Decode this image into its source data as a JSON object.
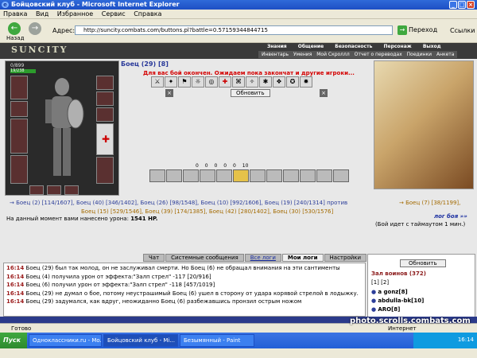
{
  "window": {
    "title": "Бойцовский клуб - Microsoft Internet Explorer"
  },
  "menu": [
    "Правка",
    "Вид",
    "Избранное",
    "Сервис",
    "Справка"
  ],
  "toolbar": {
    "back_label": "Назад",
    "address_label": "Адрес:",
    "address_value": "http://suncity.combats.com/buttons.pl?battle=0.57159344844715",
    "go_label": "Переход",
    "links_label": "Ссылки"
  },
  "site": {
    "logo": "SUNCITY",
    "nav_top": [
      "Знания",
      "Общение",
      "Безопасность",
      "Персонаж",
      "Выход"
    ],
    "nav_bottom": [
      "Инвентарь",
      "Умения",
      "Мой Скроллл",
      "Отчет о переводах",
      "Поединки",
      "Анкета"
    ]
  },
  "character": {
    "hp": "0/899",
    "mana": "19/238",
    "title": "Боец (29) [8]"
  },
  "battle": {
    "message": "Для вас бой окончен. Ожидаем пока закончат и другие игроки...",
    "refresh_label": "Обновить",
    "counters": [
      "0",
      "0",
      "0",
      "0",
      "0",
      "10"
    ],
    "team1": "→ Боец (2) [114/1607], Боец (40) [346/1402], Боец (26) [98/1548], Боец (10) [992/1606], Боец (19) [240/1314] против",
    "team1_cont": "Боец (15) [529/1546], Боец (39) [174/1385], Боец (42) [280/1402], Боец (30) [530/1576]",
    "team2": "→ Боец (7) [38/1199],",
    "damage_text": "На данный момент вами нанесено урона:",
    "damage_value": "1541 HP.",
    "fightlog_link": "лог боя »»",
    "timeout_text": "(Бой идет с таймаутом 1 мин.)"
  },
  "chat": {
    "tabs": [
      "Чат",
      "Системные сообщения",
      "Все логи",
      "Мои логи",
      "Настройки"
    ],
    "lines": [
      {
        "time": "16:14",
        "text": "Боец (29) был так молод, он не заслуживал смерти. Но Боец (6) не обращал внимания на эти сантименты"
      },
      {
        "time": "16:14",
        "text": "Боец (4) получила урон от эффекта:\"Залп стрел\" -117 [20/916]"
      },
      {
        "time": "16:14",
        "text": "Боец (6) получил урон от эффекта:\"Залп стрел\" -118 [457/1019]"
      },
      {
        "time": "16:14",
        "text": "Боец (29) не думал о бое, потому неустрашимый Боец (6) ушел в сторону от удара корявой стрелой в лодыжку."
      },
      {
        "time": "16:14",
        "text": "Боец (29) задумался, как вдруг, неожиданно Боец (6) разбежавшись пронзил острым ножом"
      }
    ]
  },
  "side": {
    "refresh_label": "Обновить",
    "title": "Зал воинов (372)",
    "pages": "[1] [2]",
    "warriors": [
      "a gonz[8]",
      "abdulla-bk[10]",
      "ARO[8]"
    ]
  },
  "status": {
    "left": "Готово",
    "zone": "Интернет"
  },
  "taskbar": {
    "start": "Пуск",
    "tasks": [
      "Одноклассники.ru - Mo...",
      "Бойцовский клуб - Mi...",
      "Безымянный - Paint"
    ],
    "clock": "16:14"
  },
  "watermark": "photo.scrolls.combats.com"
}
